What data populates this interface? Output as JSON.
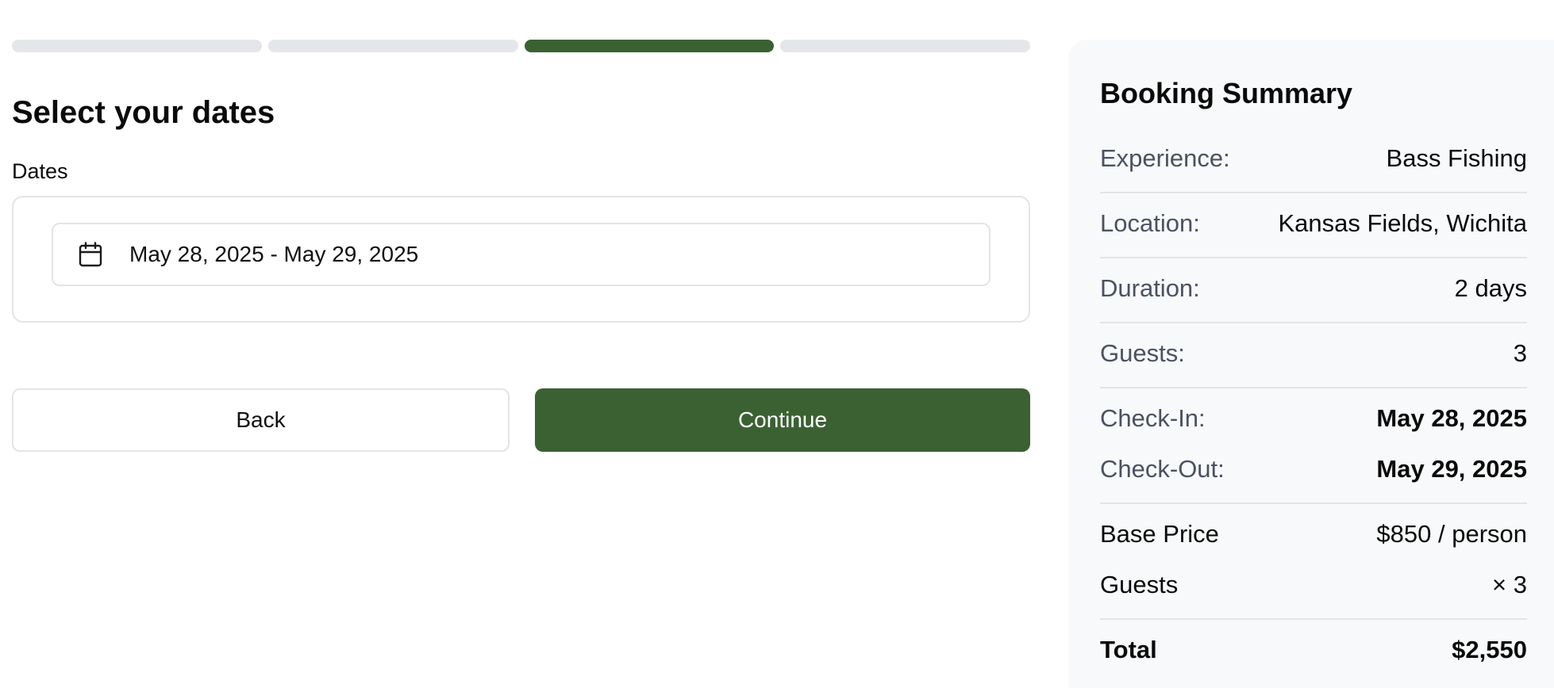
{
  "progress": {
    "steps": 4,
    "current_step": 3
  },
  "page": {
    "title": "Select your dates",
    "dates_label": "Dates",
    "date_range_value": "May 28, 2025 - May 29, 2025"
  },
  "actions": {
    "back_label": "Back",
    "continue_label": "Continue"
  },
  "summary": {
    "title": "Booking Summary",
    "experience_label": "Experience:",
    "experience_value": "Bass Fishing",
    "location_label": "Location:",
    "location_value": "Kansas Fields, Wichita",
    "duration_label": "Duration:",
    "duration_value": "2 days",
    "guests_label": "Guests:",
    "guests_value": "3",
    "checkin_label": "Check-In:",
    "checkin_value": "May 28, 2025",
    "checkout_label": "Check-Out:",
    "checkout_value": "May 29, 2025",
    "base_price_label": "Base Price",
    "base_price_value": "$850 / person",
    "guests_mult_label": "Guests",
    "guests_mult_value": "× 3",
    "total_label": "Total",
    "total_value": "$2,550"
  },
  "colors": {
    "accent": "#3b6133",
    "track": "#e5e6ea",
    "panel": "#f8f9fa"
  }
}
